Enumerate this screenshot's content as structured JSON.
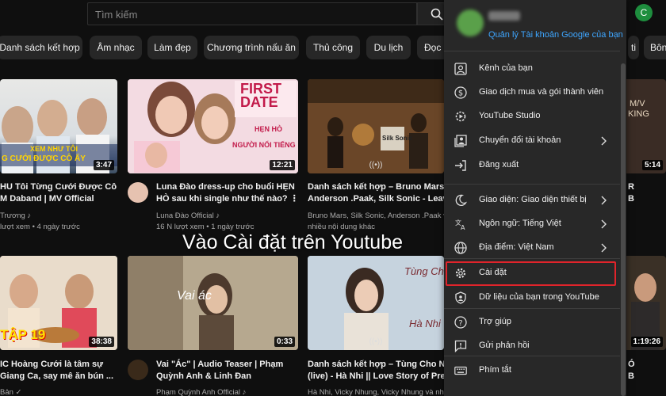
{
  "search": {
    "placeholder": "Tìm kiếm"
  },
  "account": {
    "avatar_letter": "C",
    "manage_link": "Quản lý Tài khoản Google của bạn"
  },
  "chips": [
    "Danh sách kết hợp",
    "Âm nhạc",
    "Làm đẹp",
    "Chương trình nấu ăn",
    "Thủ công",
    "Du lịch",
    "Đọc r",
    "ti",
    "Bôn"
  ],
  "videos": [
    {
      "thumb_text": [
        "XEM NHƯ TÔI",
        "G CƯỚI ĐƯỢC CÔ ẤY"
      ],
      "duration": "3:47",
      "title": [
        "HU Tôi Từng Cưới Được Cô",
        "M Daband | MV Official"
      ],
      "channel": "Trương ♪",
      "stats": "lượt xem • 4 ngày trước"
    },
    {
      "thumb_text": [
        "FIRST DATE",
        "NGƯỜI NỔI TIẾNG",
        "HẸN HÒ"
      ],
      "duration": "12:21",
      "title": [
        "Luna Đào dress-up cho buổi HẸN",
        "HÒ sau khi single như thế nào? ⋮"
      ],
      "channel": "Luna Đào Official ♪",
      "stats": "16 N lượt xem • 1 ngày trước"
    },
    {
      "thumb_text": [
        "Silk Sonic"
      ],
      "duration": "((•))",
      "title": [
        "Danh sách kết hợp – Bruno Mars,",
        "Anderson .Paak, Silk Sonic - Leave th"
      ],
      "channel": "Bruno Mars, Silk Sonic, Anderson .Paak và",
      "stats": "nhiều nội dung khác"
    },
    {
      "thumb_text": [
        "M/V",
        "KING"
      ],
      "duration": "5:14",
      "title": [
        "R",
        "B"
      ],
      "channel": "",
      "stats": ""
    },
    {
      "thumb_text": [
        "TẬP 19"
      ],
      "duration": "38:38",
      "title": [
        "IC Hoàng Cưới là tâm sự",
        "Giang Ca, say mê ăn bún ..."
      ],
      "channel": "Bản ✓",
      "stats": ""
    },
    {
      "thumb_text": [
        "Vai ác"
      ],
      "duration": "0:33",
      "title": [
        "Vai \"Ác\" | Audio Teaser | Phạm",
        "Quỳnh Anh & Linh Đan"
      ],
      "channel": "Phạm Quỳnh Anh Official ♪",
      "stats": ""
    },
    {
      "thumb_text": [
        "Tùng Cho Nh",
        "Hà Nhi"
      ],
      "duration": "((•))",
      "title": [
        "Danh sách kết hợp – Tùng Cho Nhau",
        "(live) - Hà Nhi || Love Story of Pretty"
      ],
      "channel": "Hà Nhi, Vicky Nhung, Vicky Nhung và nhiều",
      "stats": ""
    },
    {
      "thumb_text": [],
      "duration": "1:19:26",
      "title": [
        "Ó",
        "B"
      ],
      "channel": "",
      "stats": ""
    }
  ],
  "caption": "Vào Cài đặt trên Youtube",
  "menu": {
    "items": [
      {
        "label": "Kênh của bạn",
        "icon": "account-box-icon",
        "chevron": false
      },
      {
        "label": "Giao dịch mua và gói thành viên",
        "icon": "dollar-circle-icon",
        "chevron": false
      },
      {
        "label": "YouTube Studio",
        "icon": "studio-gear-icon",
        "chevron": false
      },
      {
        "label": "Chuyển đổi tài khoản",
        "icon": "switch-account-icon",
        "chevron": true
      },
      {
        "label": "Đăng xuất",
        "icon": "sign-out-icon",
        "chevron": false
      },
      {
        "label": "Giao diện: Giao diện thiết bị",
        "icon": "moon-icon",
        "chevron": true
      },
      {
        "label": "Ngôn ngữ: Tiếng Việt",
        "icon": "translate-icon",
        "chevron": true
      },
      {
        "label": "Địa điểm: Việt Nam",
        "icon": "globe-icon",
        "chevron": true
      },
      {
        "label": "Cài đặt",
        "icon": "settings-gear-icon",
        "chevron": false
      },
      {
        "label": "Dữ liệu của bạn trong YouTube",
        "icon": "shield-person-icon",
        "chevron": false
      },
      {
        "label": "Trợ giúp",
        "icon": "help-icon",
        "chevron": false
      },
      {
        "label": "Gửi phản hồi",
        "icon": "feedback-icon",
        "chevron": false
      },
      {
        "label": "Phím tắt",
        "icon": "keyboard-icon",
        "chevron": false
      }
    ]
  },
  "colors": {
    "background": "#0f0f0f",
    "menu": "#282828",
    "link": "#3ea6ff",
    "highlight": "#e0242b"
  }
}
